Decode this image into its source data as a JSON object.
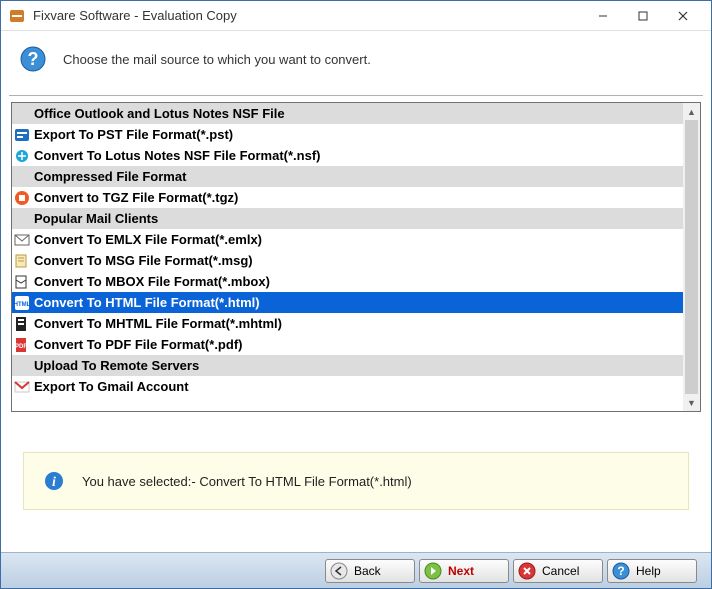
{
  "window": {
    "title": "Fixvare Software - Evaluation Copy"
  },
  "prompt": "Choose the mail source to which you want to convert.",
  "list": [
    {
      "type": "header",
      "label": "Office Outlook and Lotus Notes NSF File"
    },
    {
      "type": "item",
      "icon": "pst",
      "label": "Export To PST File Format(*.pst)"
    },
    {
      "type": "item",
      "icon": "nsf",
      "label": "Convert To Lotus Notes NSF File Format(*.nsf)"
    },
    {
      "type": "header",
      "label": "Compressed File Format"
    },
    {
      "type": "item",
      "icon": "tgz",
      "label": "Convert to TGZ File Format(*.tgz)"
    },
    {
      "type": "header",
      "label": "Popular Mail Clients"
    },
    {
      "type": "item",
      "icon": "emlx",
      "label": "Convert To EMLX File Format(*.emlx)"
    },
    {
      "type": "item",
      "icon": "msg",
      "label": "Convert To MSG File Format(*.msg)"
    },
    {
      "type": "item",
      "icon": "mbox",
      "label": "Convert To MBOX File Format(*.mbox)"
    },
    {
      "type": "item",
      "icon": "html",
      "label": "Convert To HTML File Format(*.html)",
      "selected": true
    },
    {
      "type": "item",
      "icon": "mhtml",
      "label": "Convert To MHTML File Format(*.mhtml)"
    },
    {
      "type": "item",
      "icon": "pdf",
      "label": "Convert To PDF File Format(*.pdf)"
    },
    {
      "type": "header",
      "label": "Upload To Remote Servers"
    },
    {
      "type": "item",
      "icon": "gmail",
      "label": "Export To Gmail Account"
    }
  ],
  "status": "You have selected:- Convert To HTML File Format(*.html)",
  "buttons": {
    "back": "Back",
    "next": "Next",
    "cancel": "Cancel",
    "help": "Help"
  }
}
